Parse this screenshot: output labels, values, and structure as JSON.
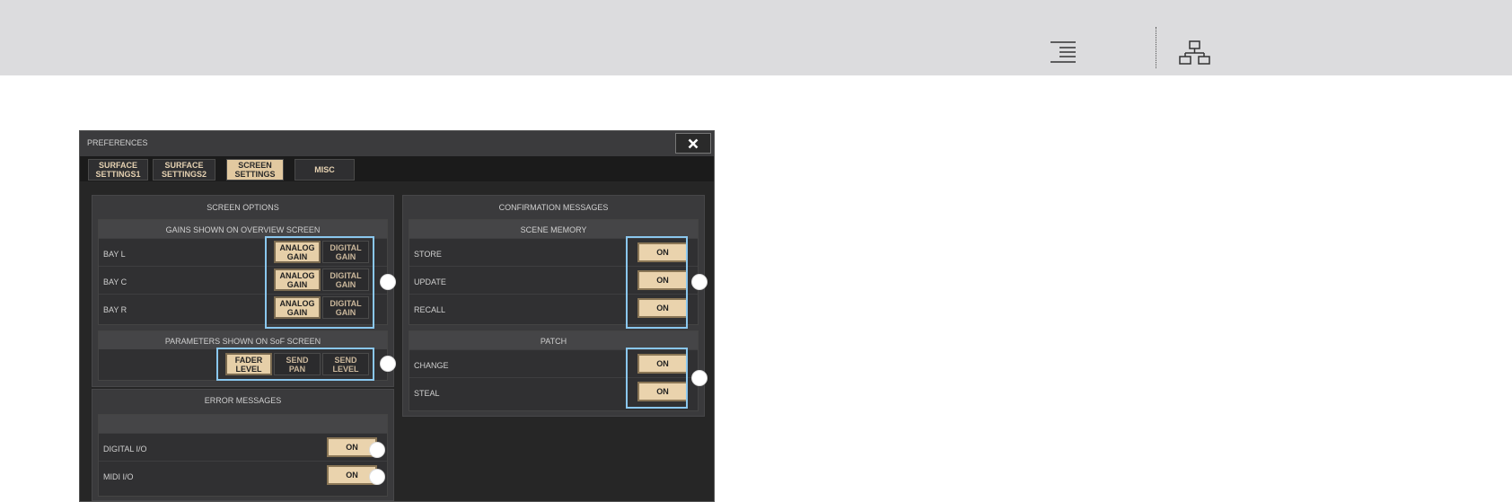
{
  "panel": {
    "title": "PREFERENCES"
  },
  "tabs": [
    {
      "label": "SURFACE\nSETTINGS1",
      "active": false
    },
    {
      "label": "SURFACE\nSETTINGS2",
      "active": false
    },
    {
      "label": "SCREEN\nSETTINGS",
      "active": true
    },
    {
      "label": "MISC",
      "active": false
    }
  ],
  "screen_options": {
    "title": "SCREEN OPTIONS",
    "gains": {
      "title": "GAINS SHOWN ON OVERVIEW SCREEN",
      "rows": [
        {
          "label": "BAY L",
          "analog": "ANALOG\nGAIN",
          "digital": "DIGITAL\nGAIN"
        },
        {
          "label": "BAY C",
          "analog": "ANALOG\nGAIN",
          "digital": "DIGITAL\nGAIN"
        },
        {
          "label": "BAY R",
          "analog": "ANALOG\nGAIN",
          "digital": "DIGITAL\nGAIN"
        }
      ]
    },
    "sof": {
      "title": "PARAMETERS SHOWN ON SoF SCREEN",
      "buttons": [
        "FADER\nLEVEL",
        "SEND\nPAN",
        "SEND\nLEVEL"
      ]
    }
  },
  "error_messages": {
    "title": "ERROR MESSAGES",
    "rows": [
      {
        "label": "DIGITAL I/O",
        "value": "ON"
      },
      {
        "label": "MIDI I/O",
        "value": "ON"
      }
    ]
  },
  "confirmation": {
    "title": "CONFIRMATION MESSAGES",
    "scene_memory": {
      "title": "SCENE MEMORY",
      "rows": [
        {
          "label": "STORE",
          "value": "ON"
        },
        {
          "label": "UPDATE",
          "value": "ON"
        },
        {
          "label": "RECALL",
          "value": "ON"
        }
      ]
    },
    "patch": {
      "title": "PATCH",
      "rows": [
        {
          "label": "CHANGE",
          "value": "ON"
        },
        {
          "label": "STEAL",
          "value": "ON"
        }
      ]
    }
  },
  "colors": {
    "highlight": "#8ac7ee",
    "button_on": "#e6cfa8",
    "panel_bg": "#262626"
  }
}
